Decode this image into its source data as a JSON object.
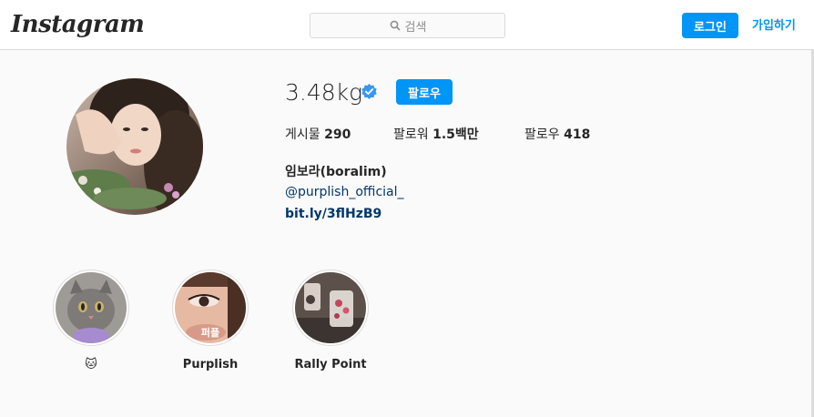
{
  "header": {
    "logo": "Instagram",
    "search_placeholder": "검색",
    "login_label": "로그인",
    "signup_label": "가입하기"
  },
  "profile": {
    "username": "3.48kg",
    "follow_label": "팔로우",
    "posts_label": "게시물",
    "posts_count": "290",
    "followers_label": "팔로워",
    "followers_count": "1.5백만",
    "following_label": "팔로우",
    "following_count": "418",
    "full_name": "임보라(boralim)",
    "mention": "@purplish_official_",
    "link": "bit.ly/3flHzB9"
  },
  "highlights": [
    {
      "label": "🐱",
      "overlay": ""
    },
    {
      "label": "Purplish",
      "overlay": "퍼플"
    },
    {
      "label": "Rally Point",
      "overlay": ""
    }
  ],
  "colors": {
    "accent": "#0095f6",
    "link": "#00376b",
    "verified": "#3897f0"
  }
}
